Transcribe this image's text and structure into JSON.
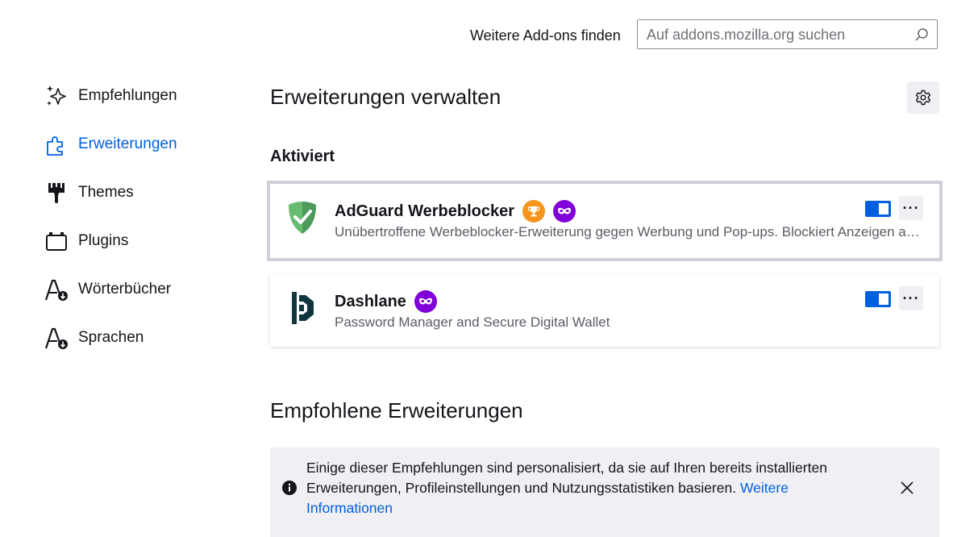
{
  "header": {
    "find_label": "Weitere Add-ons finden",
    "search_placeholder": "Auf addons.mozilla.org suchen"
  },
  "sidebar": {
    "items": [
      {
        "label": "Empfehlungen",
        "icon": "sparkle-icon"
      },
      {
        "label": "Erweiterungen",
        "icon": "puzzle-icon",
        "active": true
      },
      {
        "label": "Themes",
        "icon": "brush-icon"
      },
      {
        "label": "Plugins",
        "icon": "plugin-icon"
      },
      {
        "label": "Wörterbücher",
        "icon": "dictionary-icon"
      },
      {
        "label": "Sprachen",
        "icon": "language-icon"
      }
    ]
  },
  "main": {
    "title": "Erweiterungen verwalten",
    "section_enabled": "Aktiviert",
    "addons": [
      {
        "name": "AdGuard Werbeblocker",
        "description": "Unübertroffene Werbeblocker-Erweiterung gegen Werbung und Pop-ups. Blockiert Anzeigen auf Facebook, YouTube und allen anderen Websites.",
        "badges": [
          "trophy-icon",
          "private-browsing-icon"
        ],
        "enabled": true,
        "more_label": "···"
      },
      {
        "name": "Dashlane",
        "description": "Password Manager and Secure Digital Wallet",
        "badges": [
          "private-browsing-icon"
        ],
        "enabled": true,
        "more_label": "···"
      }
    ],
    "recommended_title": "Empfohlene Erweiterungen",
    "notice": {
      "text": "Einige dieser Empfehlungen sind personalisiert, da sie auf Ihren bereits installierten Erweiterungen, Profileinstellungen und Nutzungsstatistiken basieren.",
      "link": "Weitere Informationen"
    }
  },
  "colors": {
    "accent": "#0061e0",
    "trophy_badge": "#f7941d",
    "private_badge": "#8000d7"
  }
}
